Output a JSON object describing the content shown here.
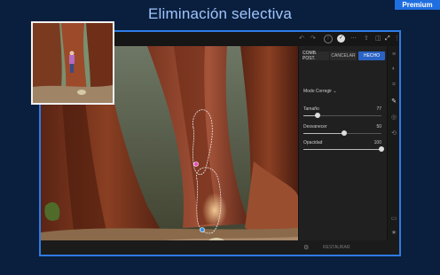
{
  "headline": "Eliminación selectiva",
  "premium_badge": "Premium",
  "panel": {
    "buttons": {
      "compare": "COMB. POST.",
      "cancel": "CANCELAR",
      "done": "HECHO"
    },
    "mode_label": "Modo Corregir",
    "sliders": [
      {
        "label": "Tamaño",
        "value": "77",
        "level": 0.18
      },
      {
        "label": "Desvanecer",
        "value": "50",
        "level": 0.52
      },
      {
        "label": "Opacidad",
        "value": "100",
        "level": 1.0
      }
    ]
  },
  "bottombar": {
    "restore_label": "RESTAURAR"
  },
  "toolbar_icons": [
    "undo-icon",
    "redo-icon",
    "info-icon",
    "check-icon",
    "more-icon",
    "share-icon",
    "compare-icon",
    "expand-icon",
    "kebab-icon"
  ],
  "rail_icons": [
    "presets-icon",
    "edit-icon",
    "crop-icon",
    "heal-icon",
    "masking-icon",
    "history-icon",
    "comment-icon",
    "star-icon",
    "info-icon"
  ],
  "colors": {
    "background": "#0a1f3d",
    "accent": "#2f7be6",
    "headline": "#9fc4ff"
  }
}
